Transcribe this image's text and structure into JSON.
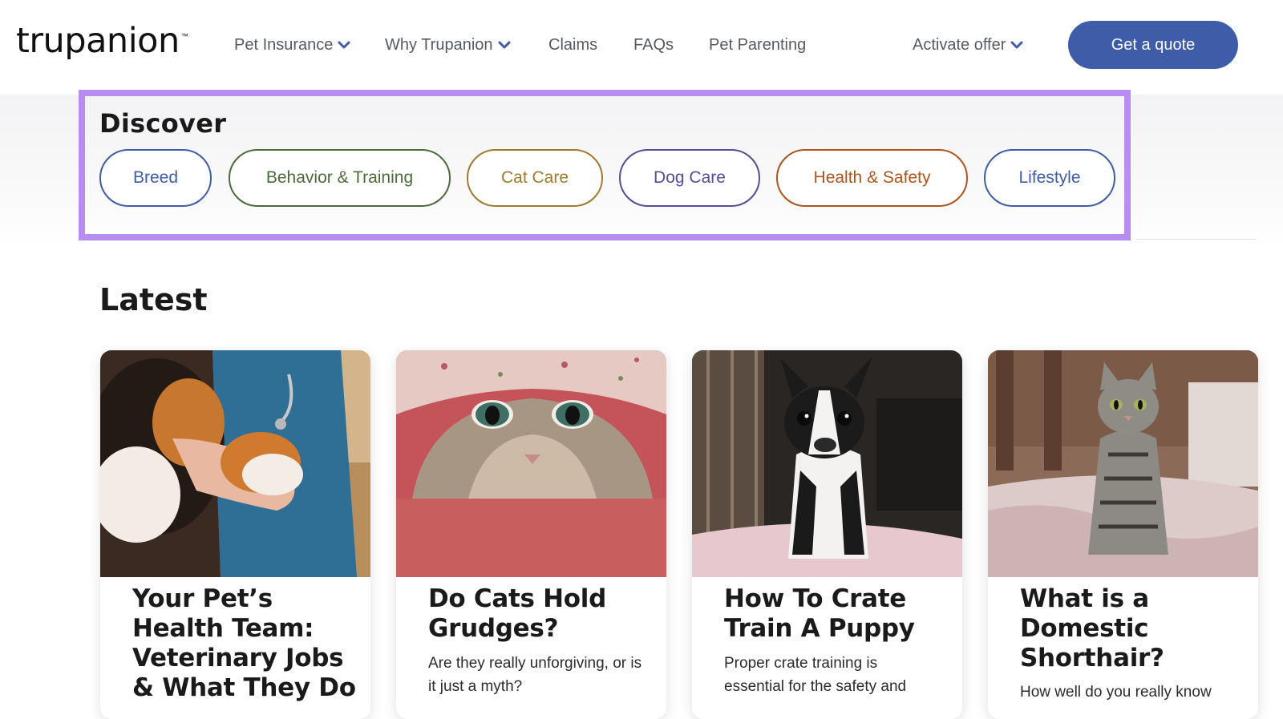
{
  "brand": {
    "logo_text": "trupanion",
    "tm": "™"
  },
  "nav": {
    "items": [
      {
        "label": "Pet Insurance",
        "has_dropdown": true
      },
      {
        "label": "Why Trupanion",
        "has_dropdown": true
      },
      {
        "label": "Claims",
        "has_dropdown": false
      },
      {
        "label": "FAQs",
        "has_dropdown": false
      },
      {
        "label": "Pet Parenting",
        "has_dropdown": false
      }
    ],
    "activate_offer": "Activate offer",
    "cta": "Get a quote"
  },
  "discover": {
    "title": "Discover",
    "chips": [
      {
        "label": "Breed",
        "color": "#3f5ca8"
      },
      {
        "label": "Behavior & Training",
        "color": "#4c6b3a"
      },
      {
        "label": "Cat Care",
        "color": "#a07a2c"
      },
      {
        "label": "Dog Care",
        "color": "#5a4a9a"
      },
      {
        "label": "Health & Safety",
        "color": "#b0531c"
      },
      {
        "label": "Lifestyle",
        "color": "#3f5ca8"
      }
    ]
  },
  "latest": {
    "title": "Latest",
    "cards": [
      {
        "title": "Your Pet’s Health Team: Veterinary Jobs & What They Do",
        "description": "",
        "image": "vet-holding-paw"
      },
      {
        "title": "Do Cats Hold Grudges?",
        "description": "Are they really unforgiving, or is it just a myth?",
        "image": "cat-under-blanket"
      },
      {
        "title": "How To Crate Train A Puppy",
        "description": "Proper crate training is essential for the safety and",
        "image": "boston-terrier-puppy"
      },
      {
        "title": "What is a Domestic Shorthair?",
        "description": "How well do you really know",
        "image": "tabby-cat-sitting"
      }
    ]
  },
  "colors": {
    "accent": "#3f5ca8",
    "highlight_border": "#b98cf2"
  }
}
